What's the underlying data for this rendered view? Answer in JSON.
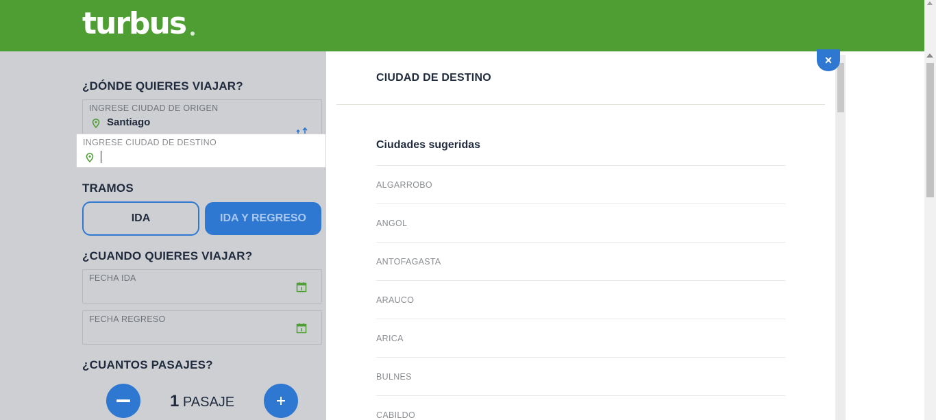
{
  "header": {
    "logo": "turbus"
  },
  "search": {
    "where_title": "¿DÓNDE QUIERES VIAJAR?",
    "origin_label": "INGRESE CIUDAD DE ORIGEN",
    "origin_value": "Santiago",
    "destination_label": "INGRESE CIUDAD DE DESTINO",
    "destination_value": "",
    "legs_title": "TRAMOS",
    "leg_one_way": "IDA",
    "leg_round_trip": "IDA Y REGRESO",
    "when_title": "¿CUANDO QUIERES VIAJAR?",
    "date_out_label": "FECHA IDA",
    "date_return_label": "FECHA REGRESO",
    "how_many_title": "¿CUANTOS PASAJES?",
    "passenger_count": "1",
    "passenger_unit": "PASAJE"
  },
  "modal": {
    "title": "CIUDAD DE DESTINO",
    "suggestions_title": "Ciudades sugeridas",
    "cities": [
      "ALGARROBO",
      "ANGOL",
      "ANTOFAGASTA",
      "ARAUCO",
      "ARICA",
      "BULNES",
      "CABILDO"
    ],
    "close_label": "×"
  },
  "colors": {
    "brand_green": "#4f9e34",
    "accent_blue": "#2e78d2",
    "panel_gray": "#cdcfd3"
  }
}
